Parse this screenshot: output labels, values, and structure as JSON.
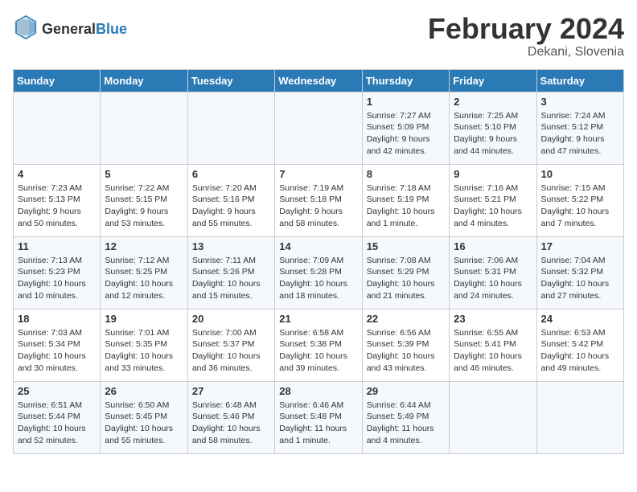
{
  "header": {
    "logo_general": "General",
    "logo_blue": "Blue",
    "month_year": "February 2024",
    "location": "Dekani, Slovenia"
  },
  "weekdays": [
    "Sunday",
    "Monday",
    "Tuesday",
    "Wednesday",
    "Thursday",
    "Friday",
    "Saturday"
  ],
  "weeks": [
    [
      {
        "day": "",
        "info": ""
      },
      {
        "day": "",
        "info": ""
      },
      {
        "day": "",
        "info": ""
      },
      {
        "day": "",
        "info": ""
      },
      {
        "day": "1",
        "info": "Sunrise: 7:27 AM\nSunset: 5:09 PM\nDaylight: 9 hours\nand 42 minutes."
      },
      {
        "day": "2",
        "info": "Sunrise: 7:25 AM\nSunset: 5:10 PM\nDaylight: 9 hours\nand 44 minutes."
      },
      {
        "day": "3",
        "info": "Sunrise: 7:24 AM\nSunset: 5:12 PM\nDaylight: 9 hours\nand 47 minutes."
      }
    ],
    [
      {
        "day": "4",
        "info": "Sunrise: 7:23 AM\nSunset: 5:13 PM\nDaylight: 9 hours\nand 50 minutes."
      },
      {
        "day": "5",
        "info": "Sunrise: 7:22 AM\nSunset: 5:15 PM\nDaylight: 9 hours\nand 53 minutes."
      },
      {
        "day": "6",
        "info": "Sunrise: 7:20 AM\nSunset: 5:16 PM\nDaylight: 9 hours\nand 55 minutes."
      },
      {
        "day": "7",
        "info": "Sunrise: 7:19 AM\nSunset: 5:18 PM\nDaylight: 9 hours\nand 58 minutes."
      },
      {
        "day": "8",
        "info": "Sunrise: 7:18 AM\nSunset: 5:19 PM\nDaylight: 10 hours\nand 1 minute."
      },
      {
        "day": "9",
        "info": "Sunrise: 7:16 AM\nSunset: 5:21 PM\nDaylight: 10 hours\nand 4 minutes."
      },
      {
        "day": "10",
        "info": "Sunrise: 7:15 AM\nSunset: 5:22 PM\nDaylight: 10 hours\nand 7 minutes."
      }
    ],
    [
      {
        "day": "11",
        "info": "Sunrise: 7:13 AM\nSunset: 5:23 PM\nDaylight: 10 hours\nand 10 minutes."
      },
      {
        "day": "12",
        "info": "Sunrise: 7:12 AM\nSunset: 5:25 PM\nDaylight: 10 hours\nand 12 minutes."
      },
      {
        "day": "13",
        "info": "Sunrise: 7:11 AM\nSunset: 5:26 PM\nDaylight: 10 hours\nand 15 minutes."
      },
      {
        "day": "14",
        "info": "Sunrise: 7:09 AM\nSunset: 5:28 PM\nDaylight: 10 hours\nand 18 minutes."
      },
      {
        "day": "15",
        "info": "Sunrise: 7:08 AM\nSunset: 5:29 PM\nDaylight: 10 hours\nand 21 minutes."
      },
      {
        "day": "16",
        "info": "Sunrise: 7:06 AM\nSunset: 5:31 PM\nDaylight: 10 hours\nand 24 minutes."
      },
      {
        "day": "17",
        "info": "Sunrise: 7:04 AM\nSunset: 5:32 PM\nDaylight: 10 hours\nand 27 minutes."
      }
    ],
    [
      {
        "day": "18",
        "info": "Sunrise: 7:03 AM\nSunset: 5:34 PM\nDaylight: 10 hours\nand 30 minutes."
      },
      {
        "day": "19",
        "info": "Sunrise: 7:01 AM\nSunset: 5:35 PM\nDaylight: 10 hours\nand 33 minutes."
      },
      {
        "day": "20",
        "info": "Sunrise: 7:00 AM\nSunset: 5:37 PM\nDaylight: 10 hours\nand 36 minutes."
      },
      {
        "day": "21",
        "info": "Sunrise: 6:58 AM\nSunset: 5:38 PM\nDaylight: 10 hours\nand 39 minutes."
      },
      {
        "day": "22",
        "info": "Sunrise: 6:56 AM\nSunset: 5:39 PM\nDaylight: 10 hours\nand 43 minutes."
      },
      {
        "day": "23",
        "info": "Sunrise: 6:55 AM\nSunset: 5:41 PM\nDaylight: 10 hours\nand 46 minutes."
      },
      {
        "day": "24",
        "info": "Sunrise: 6:53 AM\nSunset: 5:42 PM\nDaylight: 10 hours\nand 49 minutes."
      }
    ],
    [
      {
        "day": "25",
        "info": "Sunrise: 6:51 AM\nSunset: 5:44 PM\nDaylight: 10 hours\nand 52 minutes."
      },
      {
        "day": "26",
        "info": "Sunrise: 6:50 AM\nSunset: 5:45 PM\nDaylight: 10 hours\nand 55 minutes."
      },
      {
        "day": "27",
        "info": "Sunrise: 6:48 AM\nSunset: 5:46 PM\nDaylight: 10 hours\nand 58 minutes."
      },
      {
        "day": "28",
        "info": "Sunrise: 6:46 AM\nSunset: 5:48 PM\nDaylight: 11 hours\nand 1 minute."
      },
      {
        "day": "29",
        "info": "Sunrise: 6:44 AM\nSunset: 5:49 PM\nDaylight: 11 hours\nand 4 minutes."
      },
      {
        "day": "",
        "info": ""
      },
      {
        "day": "",
        "info": ""
      }
    ]
  ]
}
